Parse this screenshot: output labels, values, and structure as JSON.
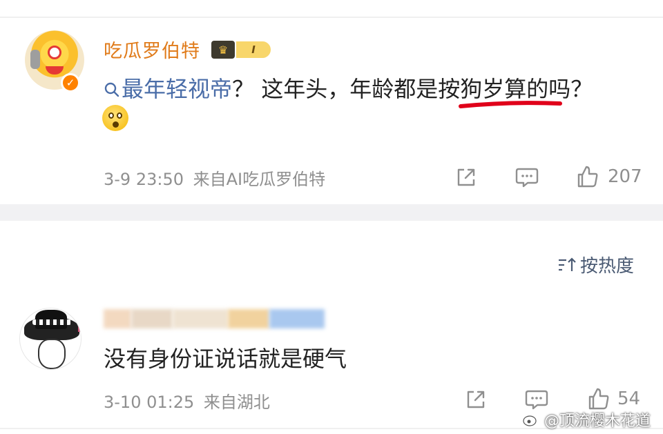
{
  "post": {
    "author": "吃瓜罗伯特",
    "level_badge": "I",
    "topic": "最年轻视帝",
    "text": "？ 这年头，年龄都是按狗岁算的吗？",
    "time": "3-9 23:50",
    "source": "来自AI吃瓜罗伯特",
    "likes": "207",
    "verified_mark": "✓"
  },
  "sort": {
    "label": "按热度"
  },
  "comment": {
    "text": "没有身份证说话就是硬气",
    "time": "3-10 01:25",
    "source": "来自湖北",
    "likes": "54"
  },
  "watermark": {
    "text": "@顶流樱木花道"
  },
  "colors": {
    "author": "#e07b1a",
    "topic": "#4a6da8",
    "meta": "#8f8f8f",
    "underline": "#e0001a"
  },
  "icons": [
    "search-icon",
    "share-icon",
    "comment-icon",
    "like-icon",
    "sort-icon",
    "weibo-icon",
    "crown-icon"
  ]
}
